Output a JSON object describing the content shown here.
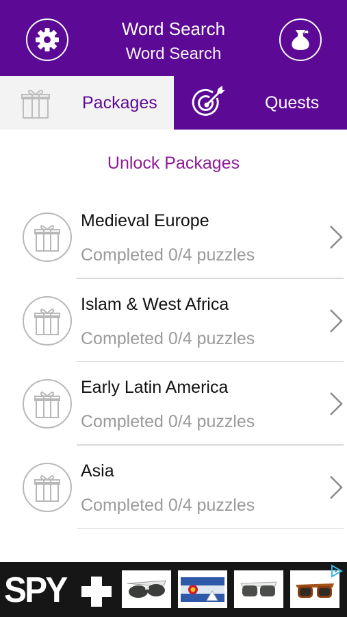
{
  "header": {
    "title": "Word Search",
    "subtitle": "Word Search",
    "settings_icon": "gear-icon",
    "store_icon": "money-bag-icon"
  },
  "tabs": [
    {
      "label": "Packages",
      "icon": "gift-icon",
      "active": true
    },
    {
      "label": "Quests",
      "icon": "target-icon",
      "active": false
    }
  ],
  "section_title": "Unlock Packages",
  "packages": [
    {
      "name": "Medieval Europe",
      "progress": "Completed 0/4 puzzles"
    },
    {
      "name": "Islam & West Africa",
      "progress": "Completed 0/4 puzzles"
    },
    {
      "name": "Early Latin America",
      "progress": "Completed 0/4 puzzles"
    },
    {
      "name": "Asia",
      "progress": "Completed 0/4 puzzles"
    }
  ],
  "ad": {
    "brand": "SPY",
    "products": [
      "sunglasses",
      "colorado-flag-print",
      "sunglasses",
      "tortoise-sunglasses"
    ]
  },
  "colors": {
    "primary": "#5c0a96",
    "accent": "#8e1a98",
    "muted_text": "#9a9a9a",
    "tab_inactive_bg": "#f3f3f3"
  }
}
